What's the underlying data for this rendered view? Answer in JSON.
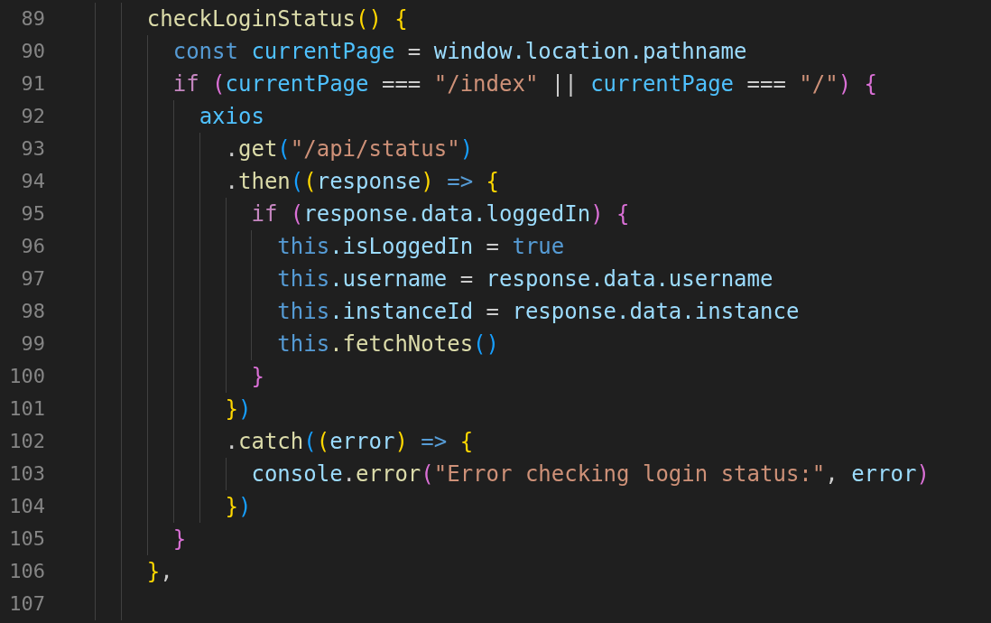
{
  "editor": {
    "lines": [
      {
        "number": "89",
        "tokens": [
          {
            "kind": "fn",
            "text": "    checkLoginStatus"
          },
          {
            "kind": "b1",
            "text": "()"
          },
          {
            "kind": "b1",
            "text": " {"
          }
        ]
      },
      {
        "number": "90",
        "tokens": [
          {
            "kind": "kw",
            "text": "      const"
          },
          {
            "kind": "cst",
            "text": " currentPage"
          },
          {
            "kind": "pun",
            "text": " = "
          },
          {
            "kind": "var",
            "text": "window.location.pathname"
          }
        ]
      },
      {
        "number": "91",
        "tokens": [
          {
            "kind": "ctl",
            "text": "      if"
          },
          {
            "kind": "b2",
            "text": " ("
          },
          {
            "kind": "cst",
            "text": "currentPage"
          },
          {
            "kind": "pun",
            "text": " === "
          },
          {
            "kind": "str",
            "text": "\"/index\""
          },
          {
            "kind": "pun",
            "text": " || "
          },
          {
            "kind": "cst",
            "text": "currentPage"
          },
          {
            "kind": "pun",
            "text": " === "
          },
          {
            "kind": "str",
            "text": "\"/\""
          },
          {
            "kind": "b2",
            "text": ")"
          },
          {
            "kind": "b2",
            "text": " {"
          }
        ]
      },
      {
        "number": "92",
        "tokens": [
          {
            "kind": "cst",
            "text": "        axios"
          }
        ]
      },
      {
        "number": "93",
        "tokens": [
          {
            "kind": "pun",
            "text": "          ."
          },
          {
            "kind": "fn",
            "text": "get"
          },
          {
            "kind": "b3",
            "text": "("
          },
          {
            "kind": "str",
            "text": "\"/api/status\""
          },
          {
            "kind": "b3",
            "text": ")"
          }
        ]
      },
      {
        "number": "94",
        "tokens": [
          {
            "kind": "pun",
            "text": "          ."
          },
          {
            "kind": "fn",
            "text": "then"
          },
          {
            "kind": "b3",
            "text": "("
          },
          {
            "kind": "b1",
            "text": "("
          },
          {
            "kind": "var",
            "text": "response"
          },
          {
            "kind": "b1",
            "text": ")"
          },
          {
            "kind": "kw",
            "text": " =>"
          },
          {
            "kind": "b1",
            "text": " {"
          }
        ]
      },
      {
        "number": "95",
        "tokens": [
          {
            "kind": "ctl",
            "text": "            if"
          },
          {
            "kind": "b2",
            "text": " ("
          },
          {
            "kind": "var",
            "text": "response.data.loggedIn"
          },
          {
            "kind": "b2",
            "text": ")"
          },
          {
            "kind": "b2",
            "text": " {"
          }
        ]
      },
      {
        "number": "96",
        "tokens": [
          {
            "kind": "kw",
            "text": "              this"
          },
          {
            "kind": "var",
            "text": ".isLoggedIn"
          },
          {
            "kind": "pun",
            "text": " = "
          },
          {
            "kind": "kw",
            "text": "true"
          }
        ]
      },
      {
        "number": "97",
        "tokens": [
          {
            "kind": "kw",
            "text": "              this"
          },
          {
            "kind": "var",
            "text": ".username"
          },
          {
            "kind": "pun",
            "text": " = "
          },
          {
            "kind": "var",
            "text": "response.data.username"
          }
        ]
      },
      {
        "number": "98",
        "tokens": [
          {
            "kind": "kw",
            "text": "              this"
          },
          {
            "kind": "var",
            "text": ".instanceId"
          },
          {
            "kind": "pun",
            "text": " = "
          },
          {
            "kind": "var",
            "text": "response.data.instance"
          }
        ]
      },
      {
        "number": "99",
        "tokens": [
          {
            "kind": "kw",
            "text": "              this"
          },
          {
            "kind": "fn",
            "text": ".fetchNotes"
          },
          {
            "kind": "b3",
            "text": "()"
          }
        ]
      },
      {
        "number": "100",
        "tokens": [
          {
            "kind": "b2",
            "text": "            }"
          }
        ]
      },
      {
        "number": "101",
        "tokens": [
          {
            "kind": "b1",
            "text": "          }"
          },
          {
            "kind": "b3",
            "text": ")"
          }
        ]
      },
      {
        "number": "102",
        "tokens": [
          {
            "kind": "pun",
            "text": "          ."
          },
          {
            "kind": "fn",
            "text": "catch"
          },
          {
            "kind": "b3",
            "text": "("
          },
          {
            "kind": "b1",
            "text": "("
          },
          {
            "kind": "var",
            "text": "error"
          },
          {
            "kind": "b1",
            "text": ")"
          },
          {
            "kind": "kw",
            "text": " =>"
          },
          {
            "kind": "b1",
            "text": " {"
          }
        ]
      },
      {
        "number": "103",
        "tokens": [
          {
            "kind": "var",
            "text": "            console"
          },
          {
            "kind": "pun",
            "text": "."
          },
          {
            "kind": "fn",
            "text": "error"
          },
          {
            "kind": "b2",
            "text": "("
          },
          {
            "kind": "str",
            "text": "\"Error checking login status:\""
          },
          {
            "kind": "pun",
            "text": ", "
          },
          {
            "kind": "var",
            "text": "error"
          },
          {
            "kind": "b2",
            "text": ")"
          }
        ]
      },
      {
        "number": "104",
        "tokens": [
          {
            "kind": "b1",
            "text": "          }"
          },
          {
            "kind": "b3",
            "text": ")"
          }
        ]
      },
      {
        "number": "105",
        "tokens": [
          {
            "kind": "b2",
            "text": "      }"
          }
        ]
      },
      {
        "number": "106",
        "tokens": [
          {
            "kind": "b1",
            "text": "    }"
          },
          {
            "kind": "pun",
            "text": ","
          }
        ]
      },
      {
        "number": "107"
      }
    ]
  }
}
